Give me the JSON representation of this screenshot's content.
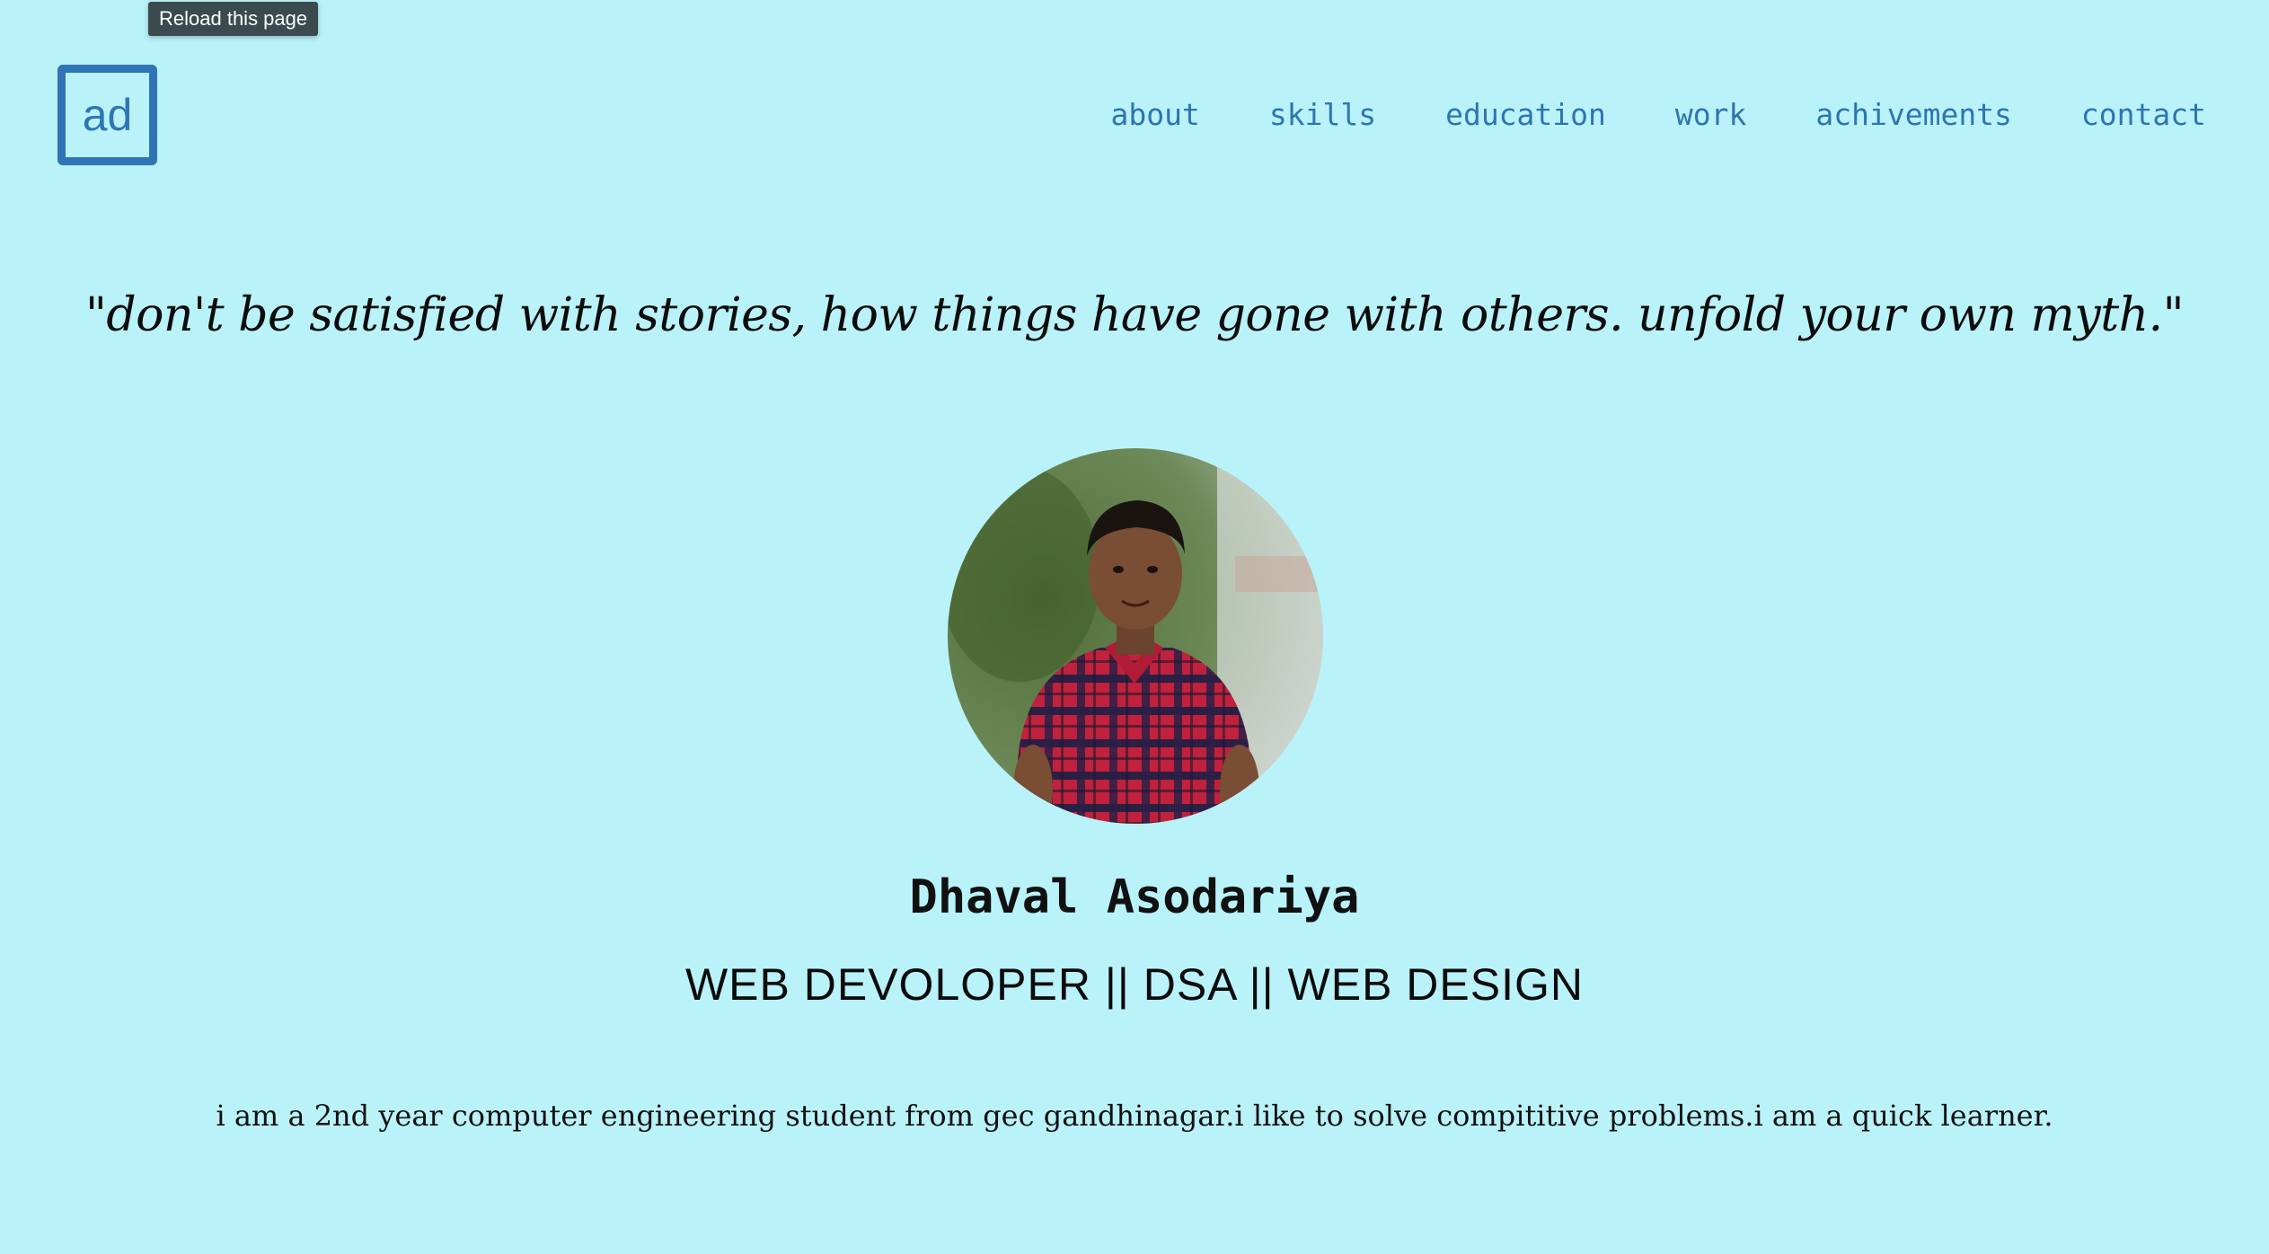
{
  "tooltip": {
    "text": "Reload this page"
  },
  "header": {
    "logo_text": "ad",
    "nav": [
      {
        "label": "about"
      },
      {
        "label": "skills"
      },
      {
        "label": "education"
      },
      {
        "label": "work"
      },
      {
        "label": "achivements"
      },
      {
        "label": "contact"
      }
    ]
  },
  "hero": {
    "quote": "\"don't be satisfied with stories, how things have gone with others. unfold your own myth.\"",
    "avatar_icon": "profile-photo",
    "name": "Dhaval Asodariya",
    "role": "WEB DEVOLOPER || DSA || WEB DESIGN",
    "bio": "i am a 2nd year computer engineering student from gec gandhinagar.i like to solve compititive problems.i am a quick learner."
  },
  "colors": {
    "background": "#b9f3f9",
    "accent": "#2f74b2",
    "tooltip_bg": "#3b4a4e"
  }
}
